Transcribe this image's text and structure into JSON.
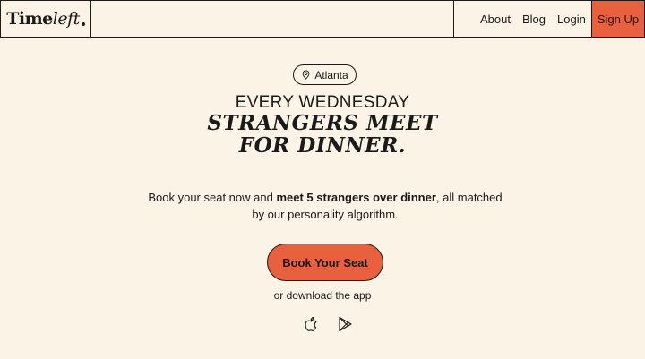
{
  "header": {
    "logo_main": "Time",
    "logo_accent": "left",
    "nav": [
      "About",
      "Blog",
      "Login"
    ],
    "signup_label": "Sign Up"
  },
  "hero": {
    "location": "Atlanta",
    "eyebrow": "EVERY WEDNESDAY",
    "headline_line1": "STRANGERS MEET",
    "headline_line2": "FOR DINNER.",
    "sub_prefix": "Book your seat now and ",
    "sub_bold": "meet 5 strangers over dinner",
    "sub_suffix": ", all matched by our personality algorithm.",
    "cta_label": "Book Your Seat",
    "download_text": "or download the app"
  },
  "colors": {
    "background": "#fbf3e6",
    "accent": "#e9603f",
    "ink": "#1a1a1a"
  },
  "icons": [
    "location-pin-icon",
    "apple-icon",
    "google-play-icon"
  ]
}
